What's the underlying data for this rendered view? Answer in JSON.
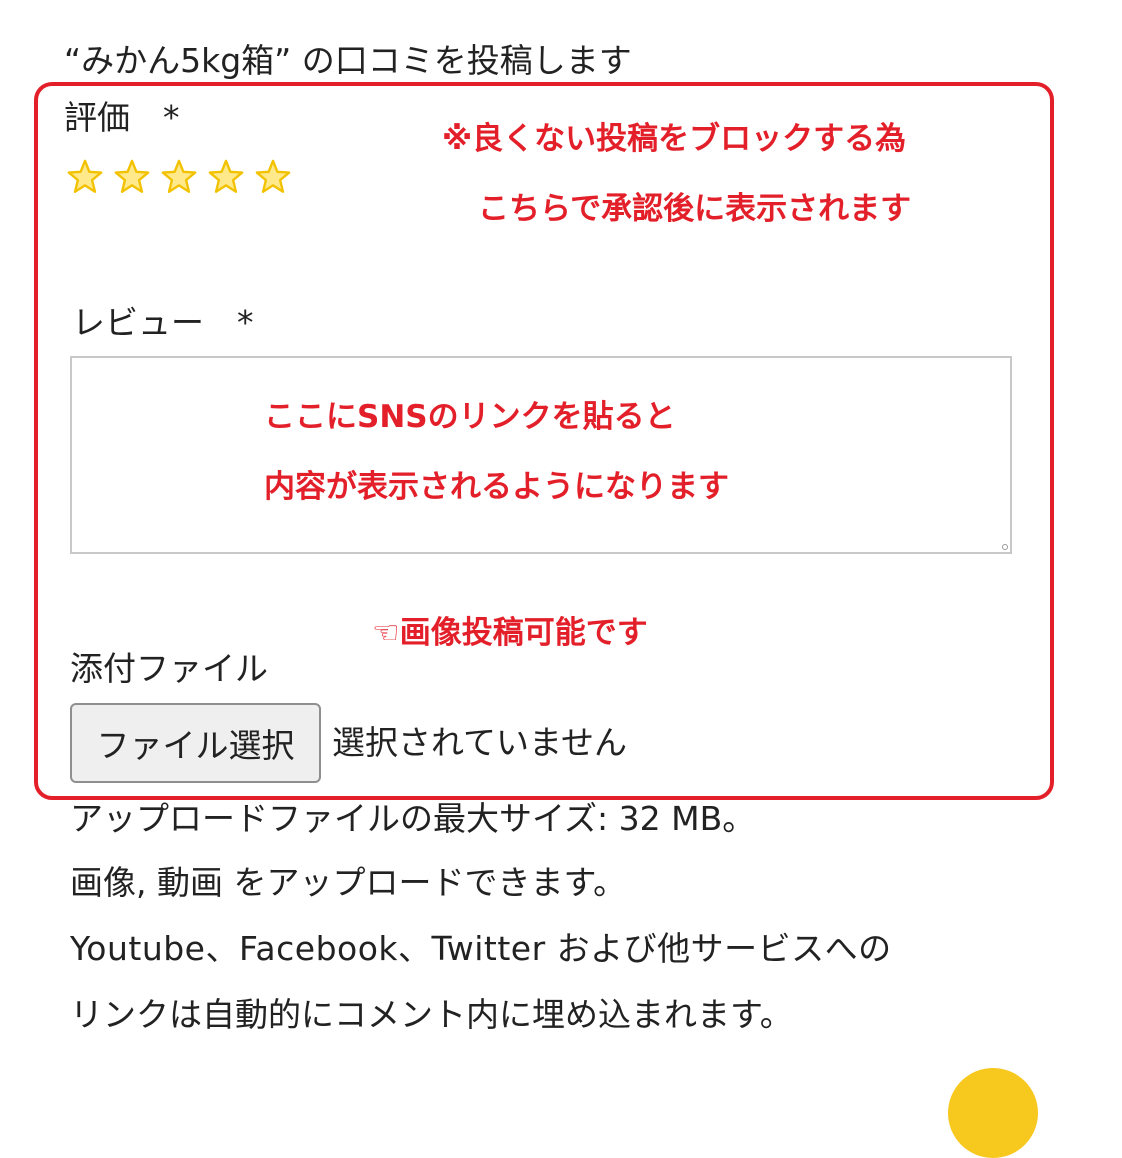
{
  "page": {
    "title": "“みかん5kg箱” の口コミを投稿します"
  },
  "form": {
    "rating_label": "評価　*",
    "rating": {
      "value": 0,
      "max": 5
    },
    "review_label": "レビュー　*",
    "review_value": "",
    "attachment_label": "添付ファイル",
    "file_button_label": "ファイル選択",
    "file_status": "選択されていません"
  },
  "info": {
    "max_size": "アップロードファイルの最大サイズ: 32 MB。",
    "types": "画像, 動画 をアップロードできます。",
    "embed_line1": "Youtube、Facebook、Twitter および他サービスへの",
    "embed_line2": "リンクは自動的にコメント内に埋め込まれます。"
  },
  "annotations": {
    "moderation_line1": "※良くない投稿をブロックする為",
    "moderation_line2": "こちらで承認後に表示されます",
    "sns_line1": "ここにSNSのリンクを貼ると",
    "sns_line2": "内容が表示されるようになります",
    "image_note": "☜画像投稿可能です"
  },
  "colors": {
    "annotation_red": "#e3202a",
    "star_fill": "#ffe98a",
    "star_stroke": "#f2c200",
    "accent_yellow": "#f7c81e"
  }
}
